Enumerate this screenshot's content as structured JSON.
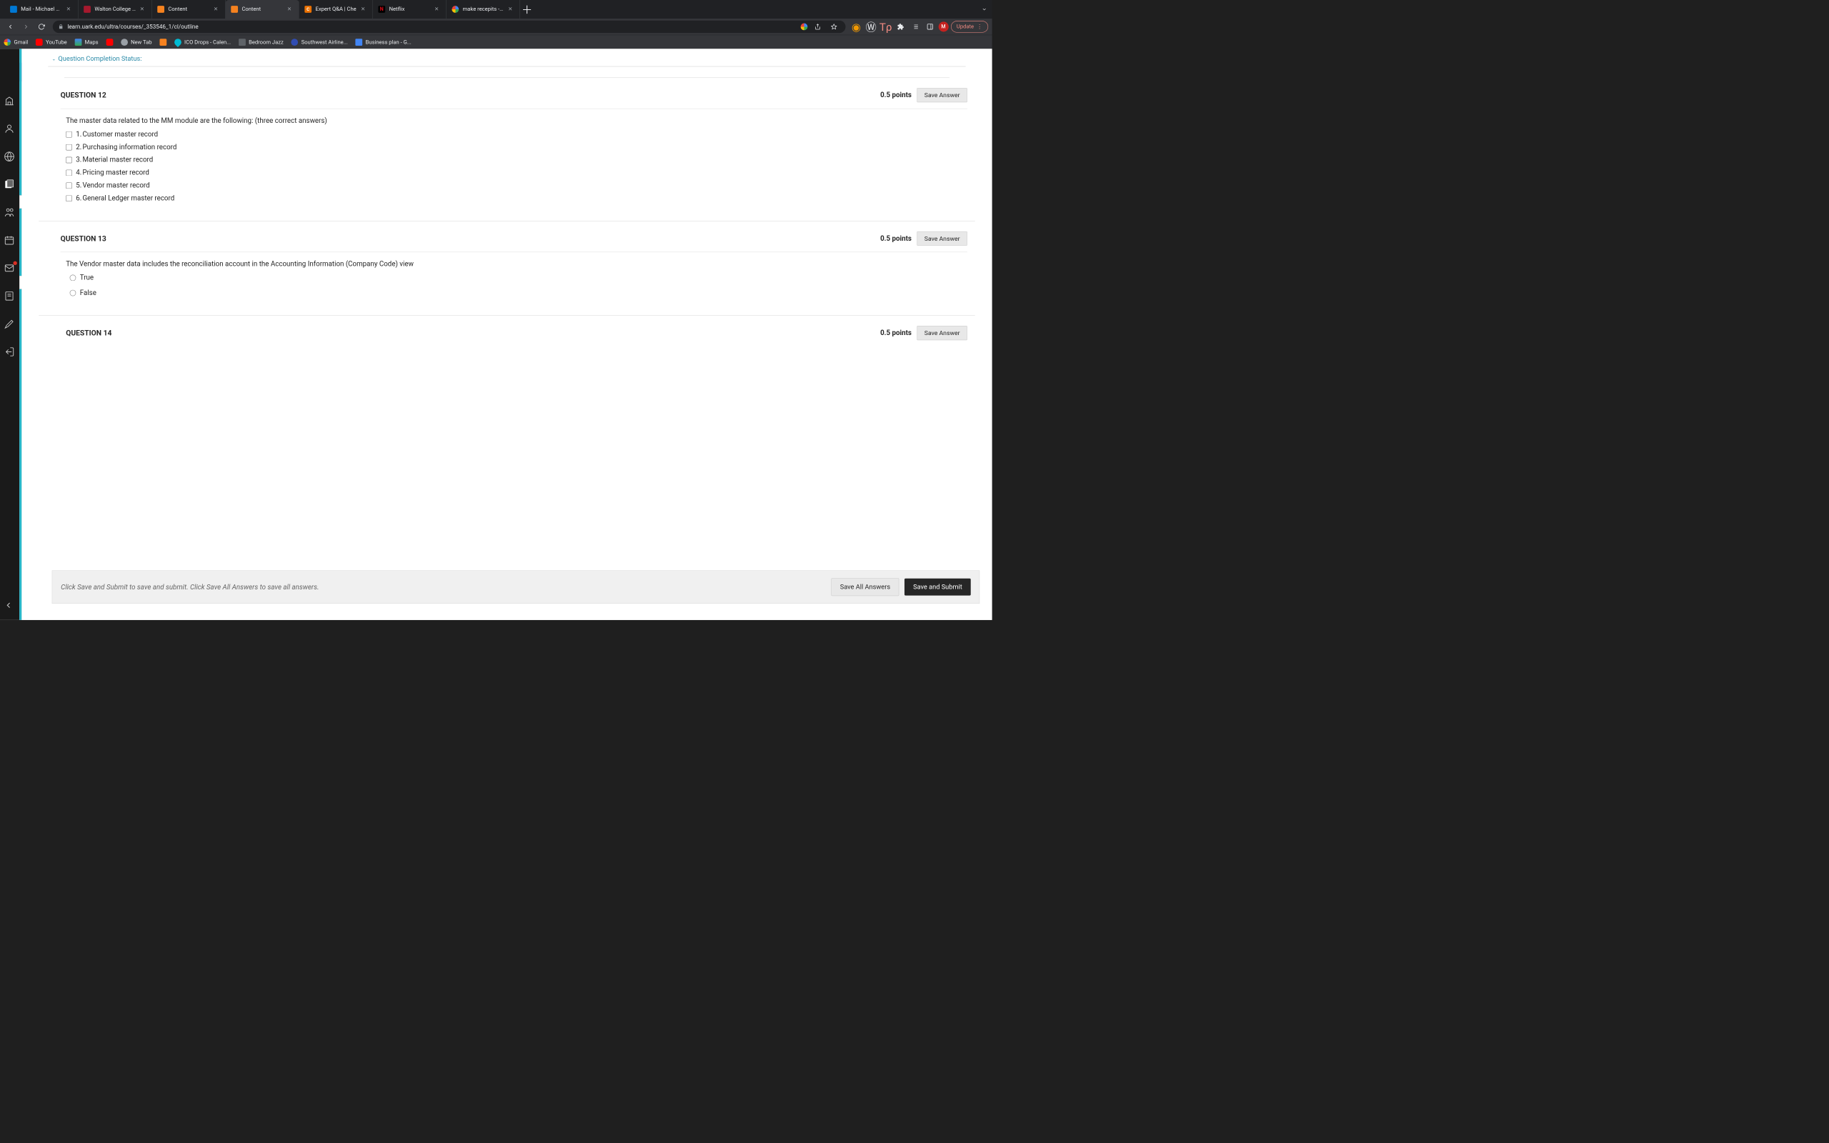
{
  "tabs": [
    {
      "title": "Mail - Michael Kul",
      "favicon": "#0078d4"
    },
    {
      "title": "Walton College Vi",
      "favicon": "#a6192e"
    },
    {
      "title": "Content",
      "favicon": "#f6821f"
    },
    {
      "title": "Content",
      "favicon": "#f6821f",
      "active": true
    },
    {
      "title": "Expert Q&A | Che",
      "favicon": "#eb7100"
    },
    {
      "title": "Netflix",
      "favicon": "#e50914"
    },
    {
      "title": "make recepits - G",
      "favicon": "#4285f4"
    }
  ],
  "url": "learn.uark.edu/ultra/courses/_353546_1/cl/outline",
  "update_label": "Update",
  "avatar": "M",
  "bookmarks": [
    {
      "label": "Gmail",
      "color": "#ea4335"
    },
    {
      "label": "YouTube",
      "color": "#ff0000"
    },
    {
      "label": "Maps",
      "color": "#34a853"
    },
    {
      "label": "",
      "color": "#ff0000"
    },
    {
      "label": "New Tab",
      "color": "#9aa0a6"
    },
    {
      "label": "",
      "color": "#f6821f"
    },
    {
      "label": "ICO Drops - Calen...",
      "color": "#00bcd4"
    },
    {
      "label": "Bedroom Jazz",
      "color": "#9aa0a6",
      "folder": true
    },
    {
      "label": "Southwest Airline...",
      "color": "#304cb2"
    },
    {
      "label": "Business plan - G...",
      "color": "#4285f4"
    }
  ],
  "status_label": "Question Completion Status:",
  "questions": [
    {
      "id": "q12",
      "title": "QUESTION 12",
      "points": "0.5 points",
      "save": "Save Answer",
      "prompt": "The master data related to the MM module are the following: (three correct answers)",
      "type": "checkbox",
      "options": [
        "Customer master record",
        "Purchasing information record",
        "Material master record",
        "Pricing master record",
        "Vendor master record",
        "General Ledger master record"
      ]
    },
    {
      "id": "q13",
      "title": "QUESTION 13",
      "points": "0.5 points",
      "save": "Save Answer",
      "prompt": "The Vendor master data includes the reconciliation account in the Accounting Information (Company Code) view",
      "type": "radio",
      "options": [
        "True",
        "False"
      ]
    },
    {
      "id": "q14",
      "title": "QUESTION 14",
      "points": "0.5 points",
      "save": "Save Answer"
    }
  ],
  "bottom": {
    "hint": "Click Save and Submit to save and submit. Click Save All Answers to save all answers.",
    "save_all": "Save All Answers",
    "submit": "Save and Submit"
  }
}
